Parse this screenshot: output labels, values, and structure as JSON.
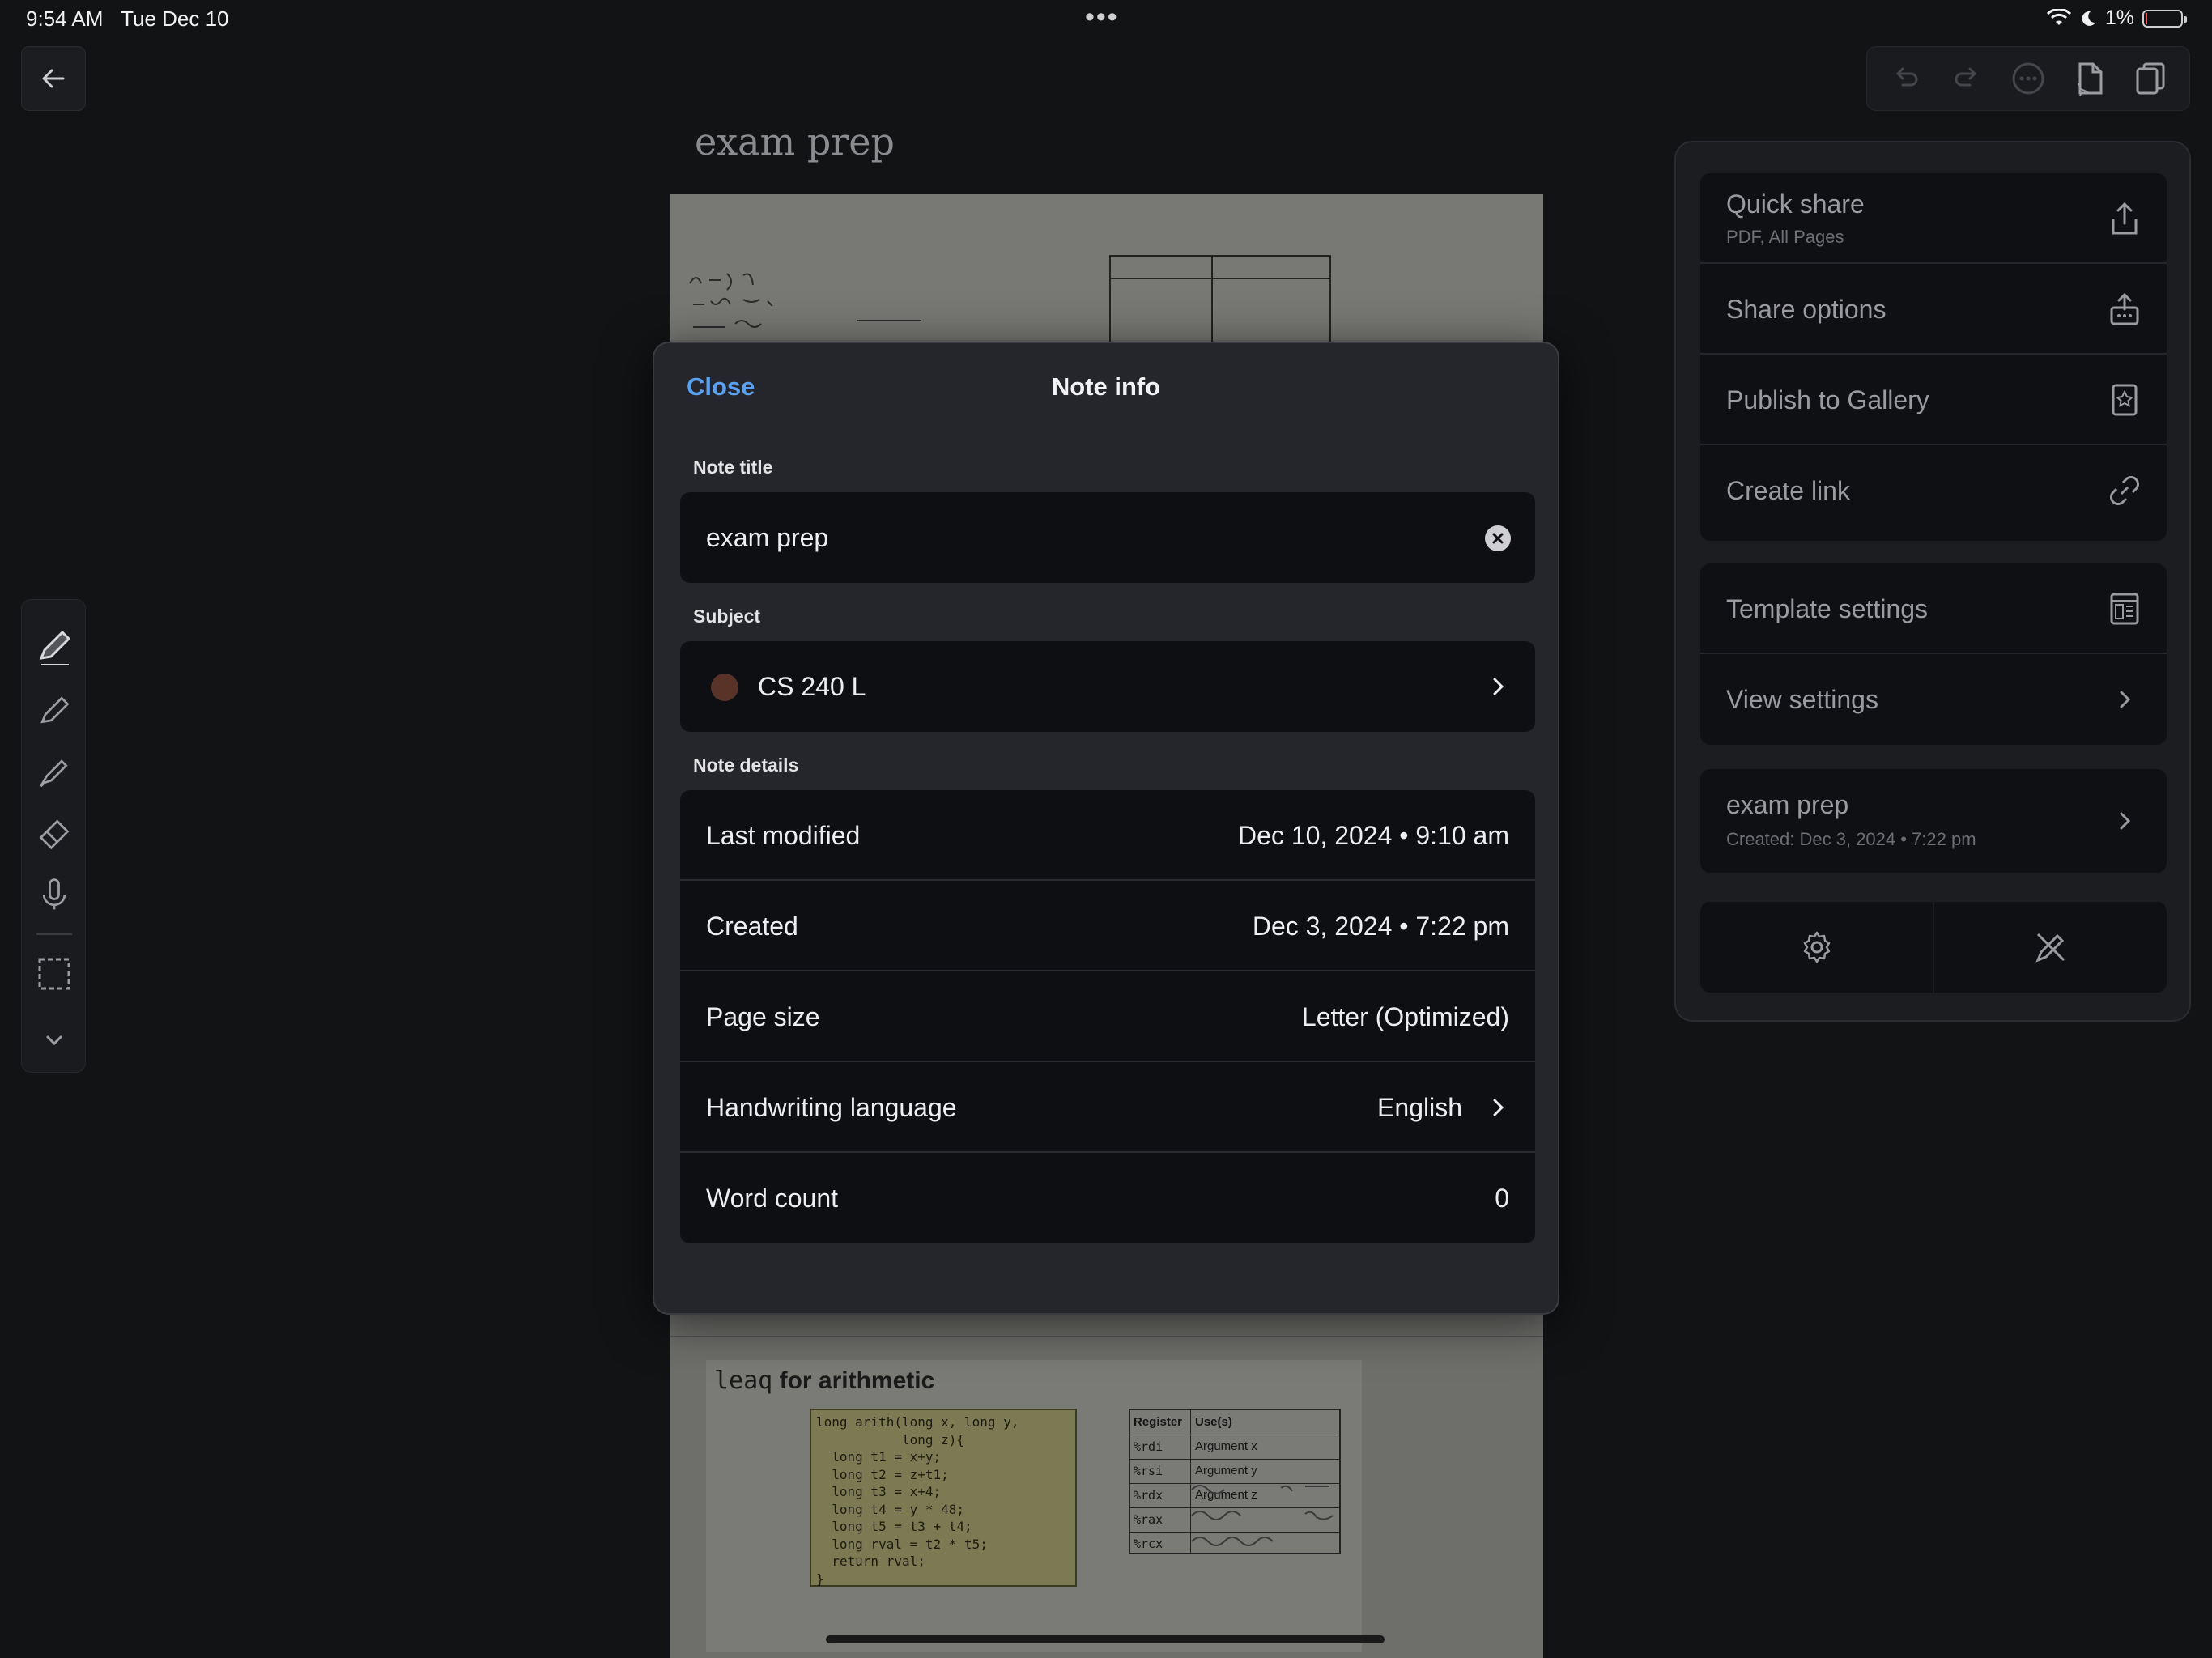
{
  "status_bar": {
    "time": "9:54 AM",
    "date": "Tue Dec 10",
    "battery": "1%",
    "center_dots": "•••"
  },
  "note": {
    "title": "exam prep"
  },
  "page_content": {
    "slide_title_code": "leaq",
    "slide_title_text": " for arithmetic",
    "code": "long arith(long x, long y,\n           long z){\n  long t1 = x+y;\n  long t2 = z+t1;\n  long t3 = x+4;\n  long t4 = y * 48;\n  long t5 = t3 + t4;\n  long rval = t2 * t5;\n  return rval;\n}",
    "register_header": [
      "Register",
      "Use(s)"
    ],
    "registers": [
      [
        "%rdi",
        "Argument x"
      ],
      [
        "%rsi",
        "Argument y"
      ],
      [
        "%rdx",
        "Argument z"
      ],
      [
        "%rax",
        ""
      ],
      [
        "%rcx",
        ""
      ]
    ]
  },
  "modal": {
    "close_label": "Close",
    "title": "Note info",
    "note_title_label": "Note title",
    "note_title_value": "exam prep",
    "subject_label": "Subject",
    "subject_value": "CS 240 L",
    "subject_color": "#5a3328",
    "details_label": "Note details",
    "details": [
      {
        "key": "Last modified",
        "value": "Dec 10, 2024 • 9:10 am"
      },
      {
        "key": "Created",
        "value": "Dec 3, 2024 • 7:22 pm"
      },
      {
        "key": "Page size",
        "value": "Letter (Optimized)"
      },
      {
        "key": "Handwriting language",
        "value": "English"
      },
      {
        "key": "Word count",
        "value": "0"
      }
    ]
  },
  "right_panel": {
    "share": [
      {
        "label": "Quick share",
        "sub": "PDF, All Pages",
        "icon": "share-upload-icon"
      },
      {
        "label": "Share options",
        "icon": "share-options-icon"
      },
      {
        "label": "Publish to Gallery",
        "icon": "gallery-icon"
      },
      {
        "label": "Create link",
        "icon": "link-icon"
      }
    ],
    "settings": [
      {
        "label": "Template settings",
        "icon": "template-icon"
      },
      {
        "label": "View settings",
        "icon": "chevron-right-icon"
      }
    ],
    "note_item": {
      "label": "exam prep",
      "sub": "Created: Dec 3, 2024 • 7:22 pm"
    }
  },
  "colors": {
    "accent": "#5aa1f2",
    "modal_bg": "#24262b",
    "field_bg": "#0e0f12"
  }
}
